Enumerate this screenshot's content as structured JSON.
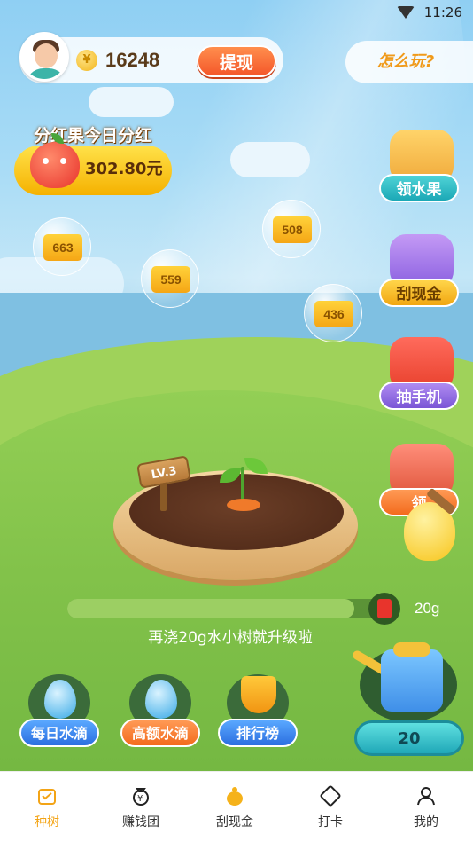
{
  "status_bar": {
    "time": "11:26"
  },
  "header": {
    "coin_value": "16248",
    "coin_symbol": "¥",
    "withdraw_label": "提现",
    "howto_label": "怎么玩?"
  },
  "dividend": {
    "title": "分红果今日分红",
    "amount": "302.80元"
  },
  "bubbles": [
    "663",
    "559",
    "508",
    "436"
  ],
  "features": [
    {
      "label": "领水果"
    },
    {
      "label": "刮现金"
    },
    {
      "label": "抽手机"
    },
    {
      "label": "领"
    }
  ],
  "plant": {
    "level": "LV.3"
  },
  "progress": {
    "remaining_label": "20g",
    "hint": "再浇20g水小树就升级啦",
    "fill_fraction": 0.9
  },
  "actions": [
    {
      "label": "每日水滴"
    },
    {
      "label": "高额水滴"
    },
    {
      "label": "排行榜"
    }
  ],
  "watering": {
    "count": "20"
  },
  "nav": [
    {
      "label": "种树",
      "icon": "tree-icon",
      "active": true
    },
    {
      "label": "赚钱团",
      "icon": "money-bag-icon",
      "active": false
    },
    {
      "label": "刮现金",
      "icon": "cash-pot-icon",
      "active": false
    },
    {
      "label": "打卡",
      "icon": "ticket-icon",
      "active": false
    },
    {
      "label": "我的",
      "icon": "profile-icon",
      "active": false
    }
  ],
  "colors": {
    "accent": "#f3a416",
    "withdraw": "#f4572a",
    "teal": "#1ba8b6"
  }
}
